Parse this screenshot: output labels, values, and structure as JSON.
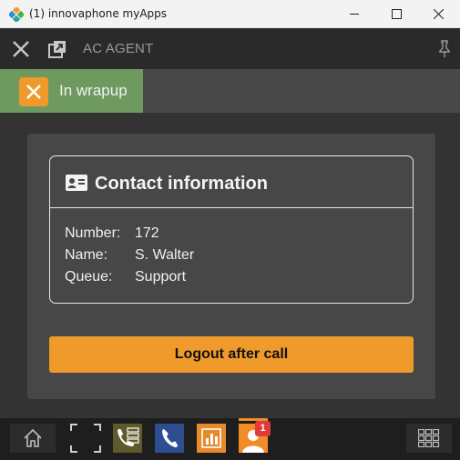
{
  "window": {
    "title": "(1) innovaphone myApps",
    "icons": [
      "innovaphone-logo-icon",
      "minimize-icon",
      "maximize-icon",
      "close-icon"
    ]
  },
  "header": {
    "title": "AC AGENT",
    "icons": [
      "close-icon",
      "popout-icon",
      "pin-icon"
    ]
  },
  "status": {
    "label": "In wrapup",
    "color": "#6e9a60",
    "icon": "x-icon"
  },
  "contact": {
    "title": "Contact information",
    "icon": "contact-card-icon",
    "fields": [
      {
        "label": "Number:",
        "value": "172"
      },
      {
        "label": "Name:",
        "value": "S. Walter"
      },
      {
        "label": "Queue:",
        "value": "Support"
      }
    ]
  },
  "actions": {
    "logout_label": "Logout after call",
    "accent": "#ef9a2a"
  },
  "dock": {
    "items": [
      "home-icon",
      "focus-icon",
      "queue-app-icon",
      "phone-app-icon",
      "reports-app-icon",
      "agent-app-icon",
      "apps-grid-icon"
    ],
    "badge_count": "1"
  }
}
